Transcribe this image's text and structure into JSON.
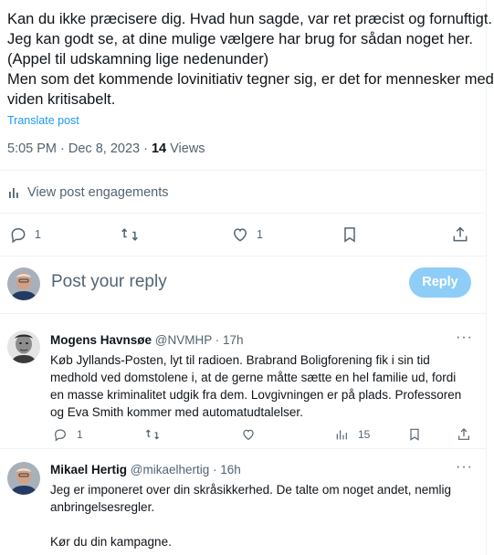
{
  "post": {
    "lines": [
      "Kan du ikke præcisere dig. Hvad hun sagde, var ret præcist og fornuftigt.",
      "Jeg kan godt se, at dine mulige vælgere har brug for sådan noget her.",
      "(Appel til udskamning lige nedenunder)",
      "Men som det kommende lovinitiativ tegner sig, er det for mennesker med",
      "viden kritisabelt."
    ],
    "translate": "Translate post",
    "timestamp": "5:05 PM · Dec 8, 2023 · ",
    "views_count": "14",
    "views_label": " Views",
    "engagements": "View post engagements",
    "replies": "1",
    "likes": "1"
  },
  "reply_box": {
    "prompt": "Post your reply",
    "button": "Reply"
  },
  "comments": [
    {
      "name": "Mogens Havnsøe",
      "handle": "@NVMHP · 17h",
      "lines": [
        "Køb Jyllands-Posten, lyt til radioen. Brabrand Boligforening fik i sin tid",
        "medhold ved domstolene i, at de gerne måtte sætte en hel familie ud, fordi",
        "en masse kriminalitet udgik fra dem. Lovgivningen er på plads. Professoren",
        "og Eva Smith kommer med automatudtalelser."
      ],
      "replies": "1",
      "views": "15"
    },
    {
      "name": "Mikael Hertig",
      "handle": "@mikaelhertig · 16h",
      "lines": [
        "Jeg er imponeret over din skråsikkerhed. De talte om noget andet, nemlig",
        "anbringelsesregler.",
        "",
        "Kør du din kampagne."
      ]
    }
  ],
  "colors": {
    "accent": "#1d9bf0",
    "reply_button": "#8ecdf8",
    "muted": "#536471"
  }
}
